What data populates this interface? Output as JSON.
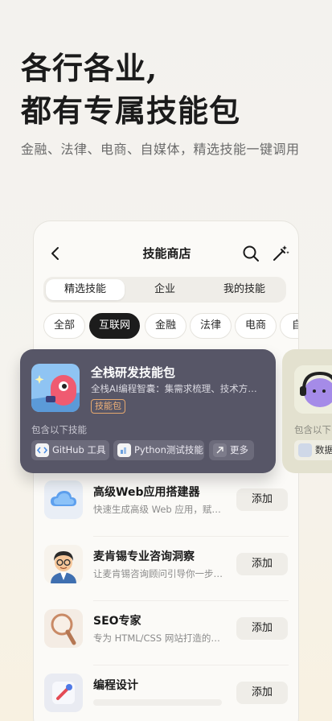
{
  "promo": {
    "headline_line1": "各行各业,",
    "headline_line2": "都有专属技能包",
    "tagline": "金融、法律、电商、自媒体，精选技能一键调用"
  },
  "store": {
    "title": "技能商店",
    "icons": [
      "back-arrow",
      "search",
      "magic-wand"
    ],
    "tabs": [
      "精选技能",
      "企业",
      "我的技能"
    ],
    "active_tab": "精选技能",
    "categories": [
      "全部",
      "互联网",
      "金融",
      "法律",
      "电商",
      "自"
    ],
    "active_category": "互联网"
  },
  "featured": {
    "title": "全栈研发技能包",
    "desc": "全栈AI编程智囊：集需求梳理、技术方…",
    "badge": "技能包",
    "contains_label": "包含以下技能",
    "skills": [
      "GitHub 工具",
      "Python测试技能",
      "更多"
    ]
  },
  "featured_next": {
    "contains_label": "包含以下",
    "skill": "数据"
  },
  "skills": [
    {
      "name": "高级Web应用搭建器",
      "desc": "快速生成高级 Web 应用，赋能…",
      "action": "添加",
      "icon": "cloud"
    },
    {
      "name": "麦肯锡专业咨询洞察",
      "desc": "让麦肯锡咨询顾问引导你一步一…",
      "action": "添加",
      "icon": "consultant-avatar"
    },
    {
      "name": "SEO专家",
      "desc": "专为 HTML/CSS 网站打造的智…",
      "action": "添加",
      "icon": "magnifier"
    },
    {
      "name": "编程设计",
      "desc": "",
      "action": "添加",
      "icon": "code-tools"
    }
  ],
  "colors": {
    "featured_card": "#575667",
    "badge": "#eeb077",
    "active_chip": "#1c1c1c"
  }
}
